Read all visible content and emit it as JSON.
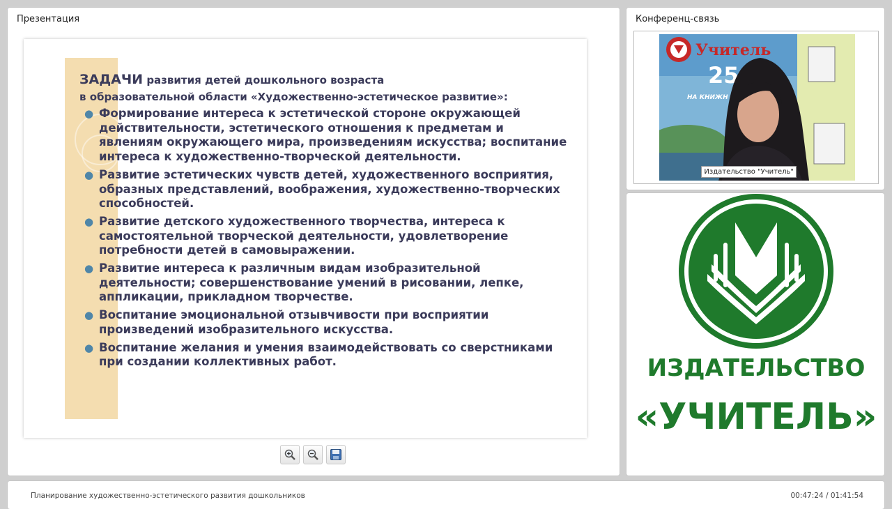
{
  "presentation": {
    "panel_title": "Презентация",
    "slide": {
      "heading_big": "ЗАДАЧИ",
      "heading_rest": " развития детей дошкольного возраста",
      "subheading": "в образовательной области «Художественно-эстетическое развитие»:",
      "bullets": [
        "Формирование интереса к эстетической стороне окружающей действительности, эстетического отношения к предметам и явлениям окружающего мира, произведениям искусства; воспитание интереса к художественно-творческой деятельности.",
        "Развитие эстетических чувств детей, художественного восприятия, образных представлений, воображения, художественно-творческих способностей.",
        "Развитие детского художественного творчества, интереса к самостоятельной творческой деятельности, удовлетворение потребности детей в самовыражении.",
        "Развитие интереса к различным видам изобразительной деятельности; совершенствование умений в рисовании, лепке, аппликации, прикладном творчестве.",
        "Воспитание эмоциональной отзывчивости при восприятии произведений изобразительного искусства.",
        "Воспитание желания и умения взаимодействовать со сверстниками при создании коллективных работ."
      ]
    },
    "toolbar": {
      "zoom_in_icon": "zoom-in-icon",
      "zoom_out_icon": "zoom-out-icon",
      "save_icon": "save-icon"
    }
  },
  "conference": {
    "panel_title": "Конференц-связь",
    "camera_label": "Издательство \"Учитель\"",
    "banner_word": "Учитель",
    "banner_years": "25",
    "banner_tagline": "НА КНИЖН"
  },
  "logo": {
    "line1": "ИЗДАТЕЛЬСТВО",
    "line2": "«УЧИТЕЛЬ»",
    "brand_color": "#1f7a2c"
  },
  "status": {
    "title": "Планирование художественно-эстетического развития дошкольников",
    "time": "00:47:24 / 01:41:54"
  }
}
